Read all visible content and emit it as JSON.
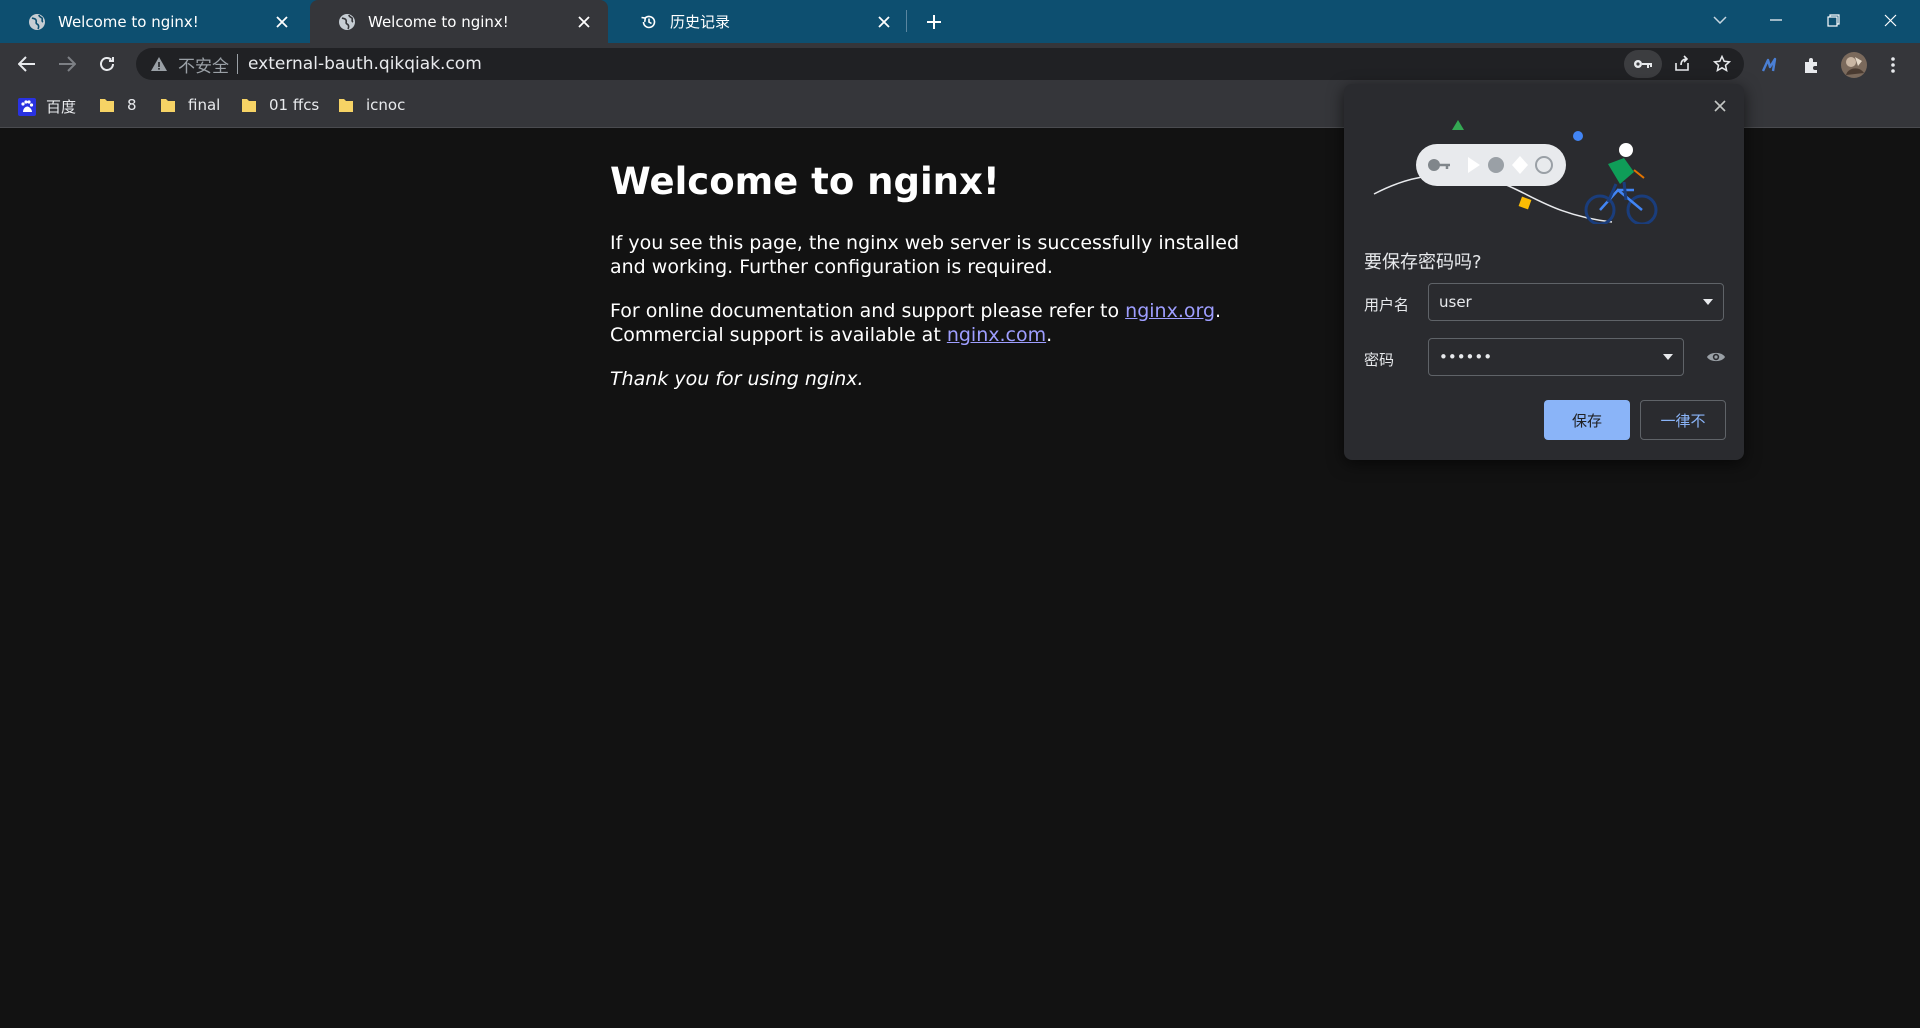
{
  "tabs": [
    {
      "title": "Welcome to nginx!",
      "icon": "globe-icon"
    },
    {
      "title": "Welcome to nginx!",
      "icon": "globe-icon"
    },
    {
      "title": "历史记录",
      "icon": "history-icon"
    }
  ],
  "omnibox": {
    "security_label": "不安全",
    "url": "external-bauth.qikqiak.com"
  },
  "bookmarks": [
    {
      "label": "百度",
      "icon": "baidu-icon"
    },
    {
      "label": "8",
      "icon": "folder-icon"
    },
    {
      "label": "final",
      "icon": "folder-icon"
    },
    {
      "label": "01 ffcs",
      "icon": "folder-icon"
    },
    {
      "label": "icnoc",
      "icon": "folder-icon"
    }
  ],
  "page": {
    "heading": "Welcome to nginx!",
    "para1": "If you see this page, the nginx web server is successfully installed and working. Further configuration is required.",
    "para2_pre": "For online documentation and support please refer to ",
    "link_org": "nginx.org",
    "para2_mid": ".",
    "para2_line2_pre": "Commercial support is available at ",
    "link_com": "nginx.com",
    "para2_end": ".",
    "para3": "Thank you for using nginx."
  },
  "password_bubble": {
    "title": "要保存密码吗?",
    "username_label": "用户名",
    "username_value": "user",
    "password_label": "密码",
    "password_value": "••••••",
    "save_label": "保存",
    "never_label": "一律不"
  },
  "colors": {
    "tabstrip": "#0d4f70",
    "toolbar": "#35363a",
    "page_bg": "#121212",
    "link": "#9e9eff",
    "accent": "#8ab4f8"
  }
}
